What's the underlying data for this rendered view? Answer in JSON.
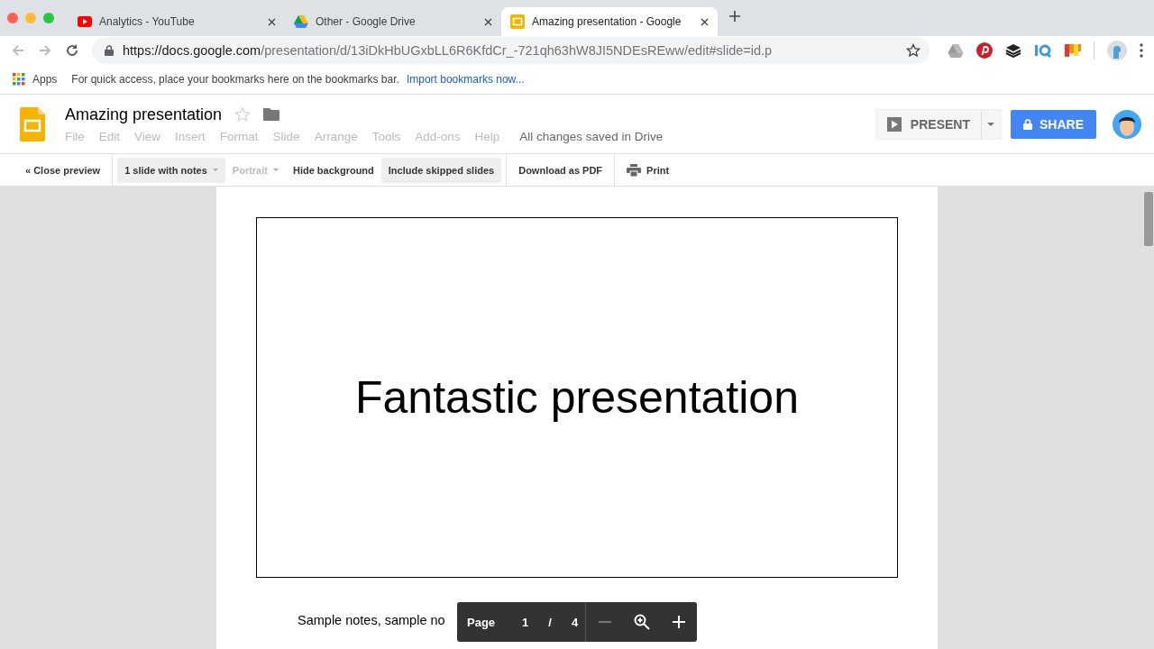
{
  "browser": {
    "tabs": [
      {
        "title": "Analytics - YouTube",
        "selected": false
      },
      {
        "title": "Other - Google Drive",
        "selected": false
      },
      {
        "title": "Amazing presentation - Google",
        "selected": true
      }
    ],
    "url_host": "https://docs.google.com",
    "url_path": "/presentation/d/13iDkHbUGxbLL6R6KfdCr_-721qh63hW8JI5NDEsREww/edit#slide=id.p",
    "bookmarks": {
      "apps": "Apps",
      "hint": "For quick access, place your bookmarks here on the bookmarks bar.",
      "link": "Import bookmarks now..."
    }
  },
  "document": {
    "title": "Amazing presentation",
    "starred": false,
    "menu": [
      {
        "label": "File",
        "disabled": true
      },
      {
        "label": "Edit",
        "disabled": true
      },
      {
        "label": "View",
        "disabled": true
      },
      {
        "label": "Insert",
        "disabled": true
      },
      {
        "label": "Format",
        "disabled": true
      },
      {
        "label": "Slide",
        "disabled": true
      },
      {
        "label": "Arrange",
        "disabled": true
      },
      {
        "label": "Tools",
        "disabled": true
      },
      {
        "label": "Add-ons",
        "disabled": true
      },
      {
        "label": "Help",
        "disabled": true
      }
    ],
    "save_status": "All changes saved in Drive",
    "present": "PRESENT",
    "share": "SHARE"
  },
  "preview_toolbar": [
    {
      "label": "« Close preview",
      "kind": "button",
      "on": false,
      "disabled": false
    },
    {
      "label": "1 slide with notes",
      "kind": "dropdown",
      "on": true,
      "disabled": false
    },
    {
      "label": "Portrait",
      "kind": "dropdown",
      "on": false,
      "disabled": true
    },
    {
      "label": "Hide background",
      "kind": "button",
      "on": false,
      "disabled": false
    },
    {
      "label": "Include skipped slides",
      "kind": "button",
      "on": true,
      "disabled": false
    },
    {
      "label": "Download as PDF",
      "kind": "button",
      "on": false,
      "disabled": false
    },
    {
      "label": "Print",
      "kind": "print",
      "on": false,
      "disabled": false
    }
  ],
  "page": {
    "slide_title": "Fantastic presentation",
    "notes": "Sample notes, sample no"
  },
  "page_controls": {
    "page_label": "Page",
    "current": "1",
    "separator": "/",
    "total": "4"
  }
}
